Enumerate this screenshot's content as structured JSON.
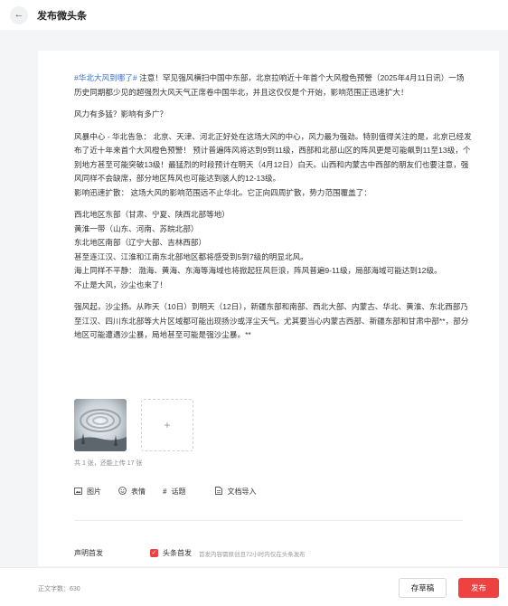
{
  "header": {
    "back_icon": "back-arrow-icon",
    "title": "发布微头条"
  },
  "post": {
    "hashtag": "#华北大风到哪了#",
    "intro": " 注意！罕见强风横扫中国中东部，北京拉响近十年首个大风橙色预警（2025年4月11日讯）一场历史同期都少见的超强烈大风天气正席卷中国华北，并且这仅仅是个开始，影响范围正迅速扩大！",
    "question": "风力有多猛？影响有多广？",
    "center_para": "风暴中心 - 华北告急： 北京、天津、河北正好处在这场大风的中心，风力最为强劲。特别值得关注的是，北京已经发布了近十年来首个大风橙色预警！ 预计普遍阵风将达到9到11级，西部和北部山区的阵风更是可能飙到11至13级，个别地方甚至可能突破13级！最猛烈的时段预计在明天（4月12日）白天。山西和内蒙古中西部的朋友们也要注意，强风同样不会缺席，部分地区阵风也可能达到骇人的12-13级。",
    "spread_para": "影响迅速扩散： 这场大风的影响范围远不止华北。它正向四周扩散，势力范围覆盖了：",
    "regions": [
      "西北地区东部（甘肃、宁夏、陕西北部等地）",
      "黄淮一带（山东、河南、苏皖北部）",
      "东北地区南部（辽宁大部、吉林西部）",
      "甚至连江汉、江淮和江南东北部地区都将感受到5到7级的明显北风。",
      "海上同样不平静： 渤海、黄海、东海等海域也将掀起狂风巨浪，阵风普遍9-11级，局部海域可能达到12级。",
      "不止是大风，沙尘也来了！"
    ],
    "dust_para": "强风起，沙尘扬。从昨天（10日）到明天（12日），新疆东部和南部、西北大部、内蒙古、华北、黄淮、东北西部乃至江汉、四川东北部等大片区域都可能出现扬沙或浮尘天气。尤其要当心内蒙古西部、新疆东部和甘肃中部**，部分地区可能遭遇沙尘暴，局地甚至可能是强沙尘暴。**"
  },
  "images": {
    "add_symbol": "+",
    "count_text": "共 1 张，还能上传 17 张"
  },
  "toolbar": [
    {
      "icon": "image-icon",
      "label": "图片"
    },
    {
      "icon": "emoji-icon",
      "label": "表情"
    },
    {
      "icon": "hashtag-icon",
      "label": "话题"
    },
    {
      "icon": "document-icon",
      "label": "文档导入"
    }
  ],
  "declaration": {
    "label": "声明首发",
    "option_label": "头条首发",
    "option_desc": "首发内容需原创且72小时内仅在头条发布",
    "checked": true
  },
  "footer": {
    "word_count": "正文字数：630",
    "draft_label": "存草稿",
    "publish_label": "发布"
  },
  "colors": {
    "accent": "#f04142",
    "hashtag": "#3b6fd6"
  }
}
